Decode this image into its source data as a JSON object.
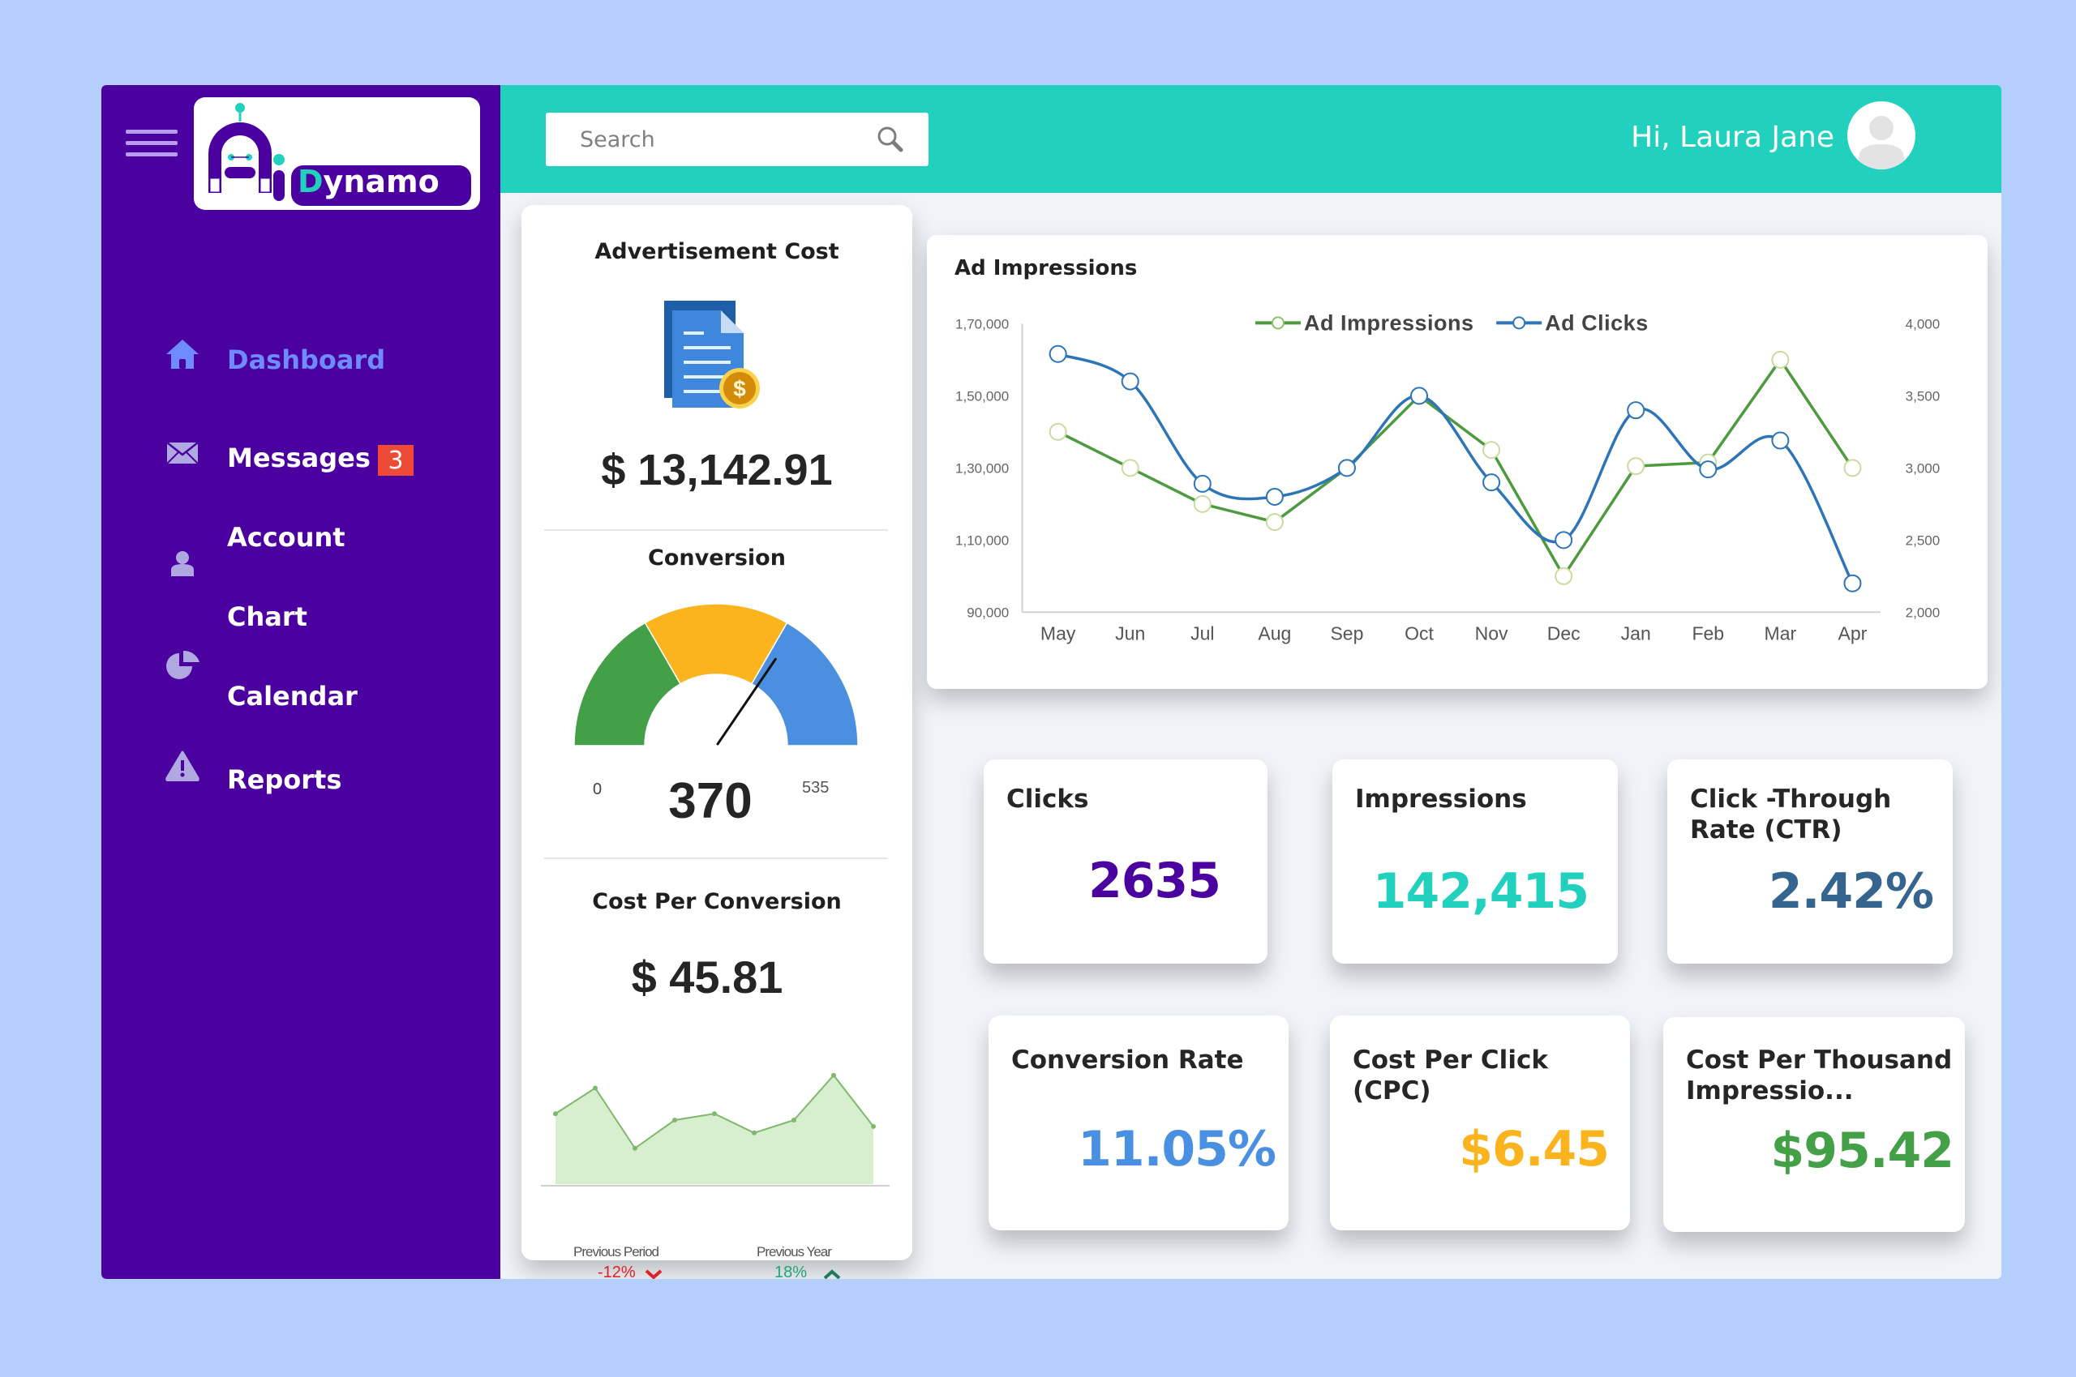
{
  "app": {
    "logo_prefix": "Ai",
    "logo_text": "Dynamo",
    "colors": {
      "sidebar": "#4b00a0",
      "topbar": "#21d1bd",
      "active_nav": "#6e8bff",
      "badge": "#ee4a35",
      "background": "#b4cffd"
    }
  },
  "sidebar": {
    "items": [
      {
        "label": "Dashboard",
        "icon": "home-icon",
        "active": true
      },
      {
        "label": "Messages",
        "icon": "envelope-icon",
        "badge": "3"
      },
      {
        "label": "Account",
        "icon": "user-icon"
      },
      {
        "label": "Chart",
        "icon": "pie-chart-icon"
      },
      {
        "label": "Calendar",
        "icon": null
      },
      {
        "label": "Reports",
        "icon": "warning-icon"
      }
    ]
  },
  "header": {
    "search_placeholder": "Search",
    "search_value": "",
    "greeting": "Hi, Laura Jane"
  },
  "left_panel": {
    "ad_cost": {
      "title": "Advertisement Cost",
      "value": "$ 13,142.91"
    },
    "conversion": {
      "title": "Conversion",
      "value": "370",
      "min": "0",
      "max": "535",
      "gauge_value": 370,
      "gauge_min": 0,
      "gauge_max": 535,
      "segment_colors": [
        "#43a047",
        "#fbb41e",
        "#4a8fe0"
      ]
    },
    "cost_per_conversion": {
      "title": "Cost Per Conversion",
      "value": "$ 45.81",
      "sparkline": [
        55,
        75,
        28,
        50,
        55,
        40,
        50,
        85,
        45
      ],
      "previous_period_label": "Previous Period",
      "previous_period_value": "-12%",
      "previous_period_trend": "down",
      "previous_year_label": "Previous Year",
      "previous_year_value": "18%",
      "previous_year_trend": "up"
    }
  },
  "chart_data": {
    "type": "line",
    "title": "Ad Impressions",
    "categories": [
      "May",
      "Jun",
      "Jul",
      "Aug",
      "Sep",
      "Oct",
      "Nov",
      "Dec",
      "Jan",
      "Feb",
      "Mar",
      "Apr"
    ],
    "series": [
      {
        "name": "Ad Impressions",
        "axis": "left",
        "color": "#4e9a3e",
        "values": [
          140000,
          130000,
          120000,
          115000,
          130000,
          150000,
          135000,
          100000,
          130500,
          131500,
          160000,
          130000
        ]
      },
      {
        "name": "Ad Clicks",
        "axis": "right",
        "color": "#2e74b8",
        "values": [
          3790,
          3600,
          2890,
          2800,
          3000,
          3500,
          2900,
          2500,
          3400,
          2990,
          3190,
          2200
        ]
      }
    ],
    "left_axis": {
      "ylim": [
        90000,
        170000
      ],
      "ticks": [
        "1,70,000",
        "1,50,000",
        "1,30,000",
        "1,10,000",
        "90,000"
      ],
      "tick_values": [
        170000,
        150000,
        130000,
        110000,
        90000
      ]
    },
    "right_axis": {
      "ylim": [
        2000,
        4000
      ],
      "ticks": [
        "4,000",
        "3,500",
        "3,000",
        "2,500",
        "2,000"
      ],
      "tick_values": [
        4000,
        3500,
        3000,
        2500,
        2000
      ]
    },
    "legend": "top-center",
    "grid": false
  },
  "kpis": [
    {
      "label": "Clicks",
      "value": "2635",
      "color": "#4b00a0"
    },
    {
      "label": "Impressions",
      "value": "142,415",
      "color": "#21d1bd"
    },
    {
      "label": "Click -Through Rate (CTR)",
      "value": "2.42%",
      "color": "#35648f"
    },
    {
      "label": "Conversion Rate",
      "value": "11.05%",
      "color": "#4a90e2"
    },
    {
      "label": "Cost Per Click (CPC)",
      "value": "$6.45",
      "color": "#fbb41e"
    },
    {
      "label": "Cost Per Thousand Impressio...",
      "value": "$95.42",
      "color": "#43a047"
    }
  ]
}
